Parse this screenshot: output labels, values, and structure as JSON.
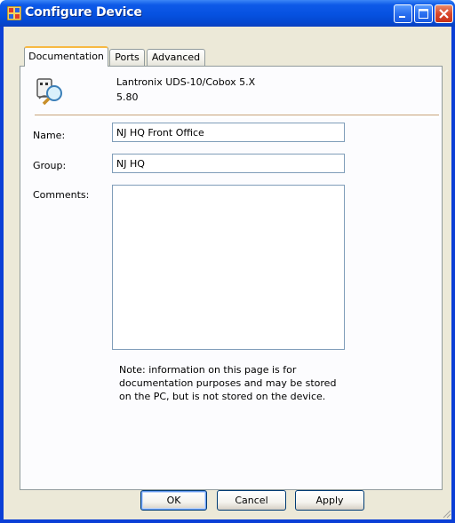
{
  "window": {
    "title": "Configure Device",
    "controls": [
      "minimize",
      "maximize",
      "close"
    ]
  },
  "tabs": [
    {
      "label": "Documentation",
      "active": true
    },
    {
      "label": "Ports",
      "active": false
    },
    {
      "label": "Advanced",
      "active": false
    }
  ],
  "device": {
    "model": "Lantronix UDS-10/Cobox 5.X",
    "version": "5.80",
    "icon": "device-search-icon"
  },
  "form": {
    "name_label": "Name:",
    "name_value": "NJ HQ Front Office",
    "group_label": "Group:",
    "group_value": "NJ HQ",
    "comments_label": "Comments:",
    "comments_value": ""
  },
  "note": "Note: information on this page is for\ndocumentation purposes and may be stored\non the PC, but is not stored on the device.",
  "buttons": {
    "ok": "OK",
    "cancel": "Cancel",
    "apply": "Apply"
  },
  "colors": {
    "titlebar": "#0651e0",
    "client": "#ece9d8",
    "active_tab_accent": "#f7b943"
  }
}
